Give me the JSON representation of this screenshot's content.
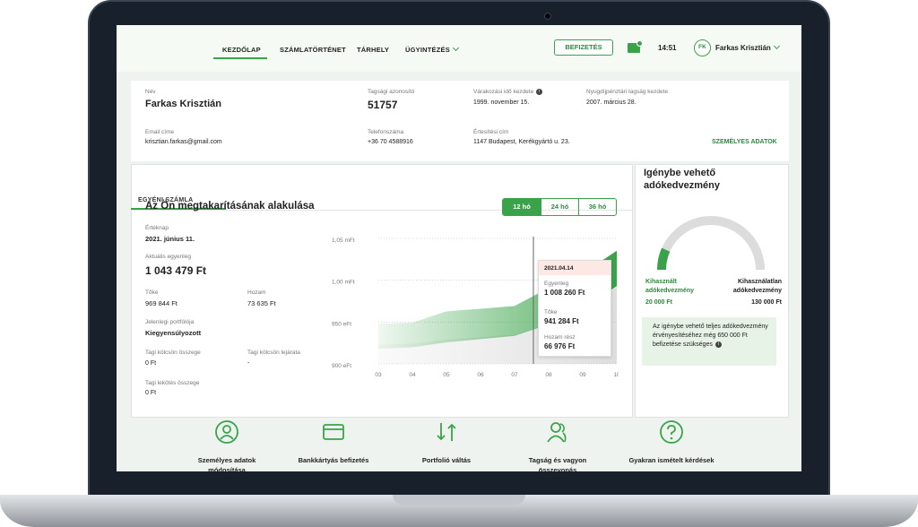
{
  "nav": {
    "home": "KEZDŐLAP",
    "history": "SZÁMLATÖRTÉNET",
    "storage": "TÁRHELY",
    "admin": "ÜGYINTÉZÉS",
    "pay": "BEFIZETÉS",
    "time": "14:51",
    "initials": "FK",
    "user": "Farkas Krisztián"
  },
  "profile": {
    "name_label": "Név",
    "name": "Farkas Krisztián",
    "member_id_label": "Tagsági azonosító",
    "member_id": "51757",
    "wait_label": "Várakozási idő kezdete",
    "wait": "1999. november 15.",
    "pension_label": "Nyugdíjpénztári tagság kezdete",
    "pension": "2007. március 28.",
    "email_label": "Email címe",
    "email": "krisztian.farkas@gmail.com",
    "phone_label": "Telefonszáma",
    "phone": "+36 70 4588916",
    "address_label": "Értesítési cím",
    "address": "1147 Budapest, Kerékgyártó u. 23.",
    "personal_link": "SZEMÉLYES ADATOK"
  },
  "account": {
    "tab": "EGYÉNI SZÁMLA",
    "title": "Az Ön megtakarításának alakulása",
    "periods": [
      "12 hó",
      "24 hó",
      "36 hó"
    ],
    "value_date_label": "Értéknap",
    "value_date": "2021. június 11.",
    "balance_label": "Aktuális egyenleg",
    "balance": "1 043 479 Ft",
    "capital_label": "Tőke",
    "capital": "969 844 Ft",
    "yield_label": "Hozam",
    "yield": "73 635 Ft",
    "portfolio_label": "Jelenlegi portfólója",
    "portfolio": "Kiegyensúlyozott",
    "loan_label": "Tagi kölcsön összege",
    "loan": "0 Ft",
    "loan_due_label": "Tagi kölcsön lejárata",
    "loan_due": "-",
    "lock_label": "Tagi lekötés összege",
    "lock": "0 Ft"
  },
  "tooltip": {
    "date": "2021.04.14",
    "balance_label": "Egyenleg",
    "balance": "1 008 260 Ft",
    "capital_label": "Tőke",
    "capital": "941 284 Ft",
    "yield_label": "Hozam rész",
    "yield": "66 976 Ft"
  },
  "chart_data": {
    "type": "area",
    "y_ticks": [
      "1,05 mFt",
      "1,00 mFt",
      "950 eFt",
      "900 eFt"
    ],
    "x": [
      "03",
      "04",
      "05",
      "06",
      "07",
      "08",
      "09",
      "10"
    ],
    "ylim": [
      900000,
      1050000
    ],
    "series": [
      {
        "values": [
          948000,
          952000,
          960000,
          966000,
          972000,
          988000,
          1008260,
          1038000
        ]
      }
    ],
    "accent": "#3aa34a"
  },
  "tax": {
    "title": "Igénybe vehető adókedvezmény",
    "used_label": "Kihasznált adókedvezmény",
    "used": "20 000 Ft",
    "unused_label": "Kihasználatlan adókedvezmény",
    "unused": "130 000 Ft",
    "used_fraction": 0.133,
    "note": "Az igénybe vehető teljes adókedvezmény érvényesítéséhez még 650 000 Ft befizetése szükséges"
  },
  "actions": [
    "Személyes adatok módosítása",
    "Bankkártyás befizetés",
    "Portfolió váltás",
    "Tagság és vagyon összevonás",
    "Gyakran ismételt kérdések"
  ]
}
